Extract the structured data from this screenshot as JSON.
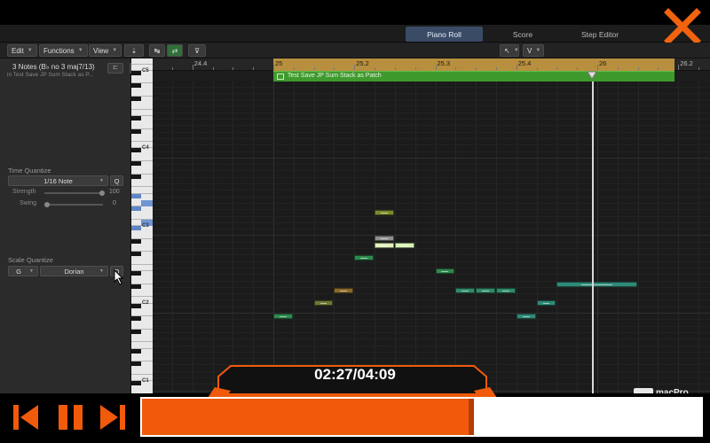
{
  "header": {
    "tabs": [
      {
        "label": "Piano Roll",
        "active": true
      },
      {
        "label": "Score",
        "active": false
      },
      {
        "label": "Step Editor",
        "active": false
      }
    ]
  },
  "toolbar": {
    "edit": "Edit",
    "functions": "Functions",
    "view": "View",
    "pointer_tool": "V"
  },
  "inspector": {
    "region_name": "3 Notes (B♭ no 3 maj7/13)",
    "region_sub": "in Test Save JP Sum Stack as P...",
    "time_quantize": {
      "label": "Time Quantize",
      "value": "1/16 Note",
      "q": "Q",
      "strength_label": "Strength",
      "strength_value": "100",
      "swing_label": "Swing",
      "swing_value": "0"
    },
    "scale_quantize": {
      "label": "Scale Quantize",
      "root": "G",
      "scale": "Dorian",
      "q": "Q"
    }
  },
  "keyboard": {
    "octaves": [
      "C5",
      "C4",
      "C3",
      "C2",
      "C1"
    ]
  },
  "ruler": {
    "bars": [
      "24.4",
      "25",
      "25.2",
      "25.3",
      "25.4",
      "26",
      "26.2"
    ]
  },
  "region": {
    "title": "Test Save JP Sum Stack as Patch"
  },
  "notes": [
    {
      "pitch": "C2",
      "start": "25.1.1",
      "length": "1/16",
      "color": "#2e8a4f"
    },
    {
      "pitch": "D2",
      "start": "25.1.3",
      "length": "1/16",
      "color": "#6c7a33"
    },
    {
      "pitch": "E2",
      "start": "25.1.4",
      "length": "1/16",
      "color": "#8a6a2a"
    },
    {
      "pitch": "A2",
      "start": "25.2.1",
      "length": "1/16",
      "color": "#2e8a4f"
    },
    {
      "pitch": "B2",
      "start": "25.2.2",
      "length": "1/16",
      "color": "#e4f2bd"
    },
    {
      "pitch": "C3",
      "start": "25.2.2",
      "length": "1/16",
      "color": "#8f8f8f"
    },
    {
      "pitch": "E3",
      "start": "25.2.2",
      "length": "1/16",
      "color": "#7c8a2c"
    },
    {
      "pitch": "B2",
      "start": "25.2.3",
      "length": "1/16",
      "color": "#d9f5b8"
    },
    {
      "pitch": "G2",
      "start": "25.3.1",
      "length": "1/16",
      "color": "#2e8a4f"
    },
    {
      "pitch": "E2",
      "start": "25.3.2",
      "length": "1/16",
      "color": "#2f8a68"
    },
    {
      "pitch": "E2",
      "start": "25.3.3",
      "length": "1/16",
      "color": "#2f8a68"
    },
    {
      "pitch": "E2",
      "start": "25.3.4",
      "length": "1/16",
      "color": "#2f8a68"
    },
    {
      "pitch": "C2",
      "start": "25.4.1",
      "length": "1/16",
      "color": "#2f8a78"
    },
    {
      "pitch": "D2",
      "start": "25.4.2",
      "length": "1/16",
      "color": "#2f8a78"
    },
    {
      "pitch": "F2",
      "start": "25.4.3",
      "length": "1/4",
      "color": "#2f8a78"
    }
  ],
  "watermark": "macPro",
  "player": {
    "time": "02:27/04:09",
    "progress": 0.59,
    "accent": "#f05a0a"
  }
}
